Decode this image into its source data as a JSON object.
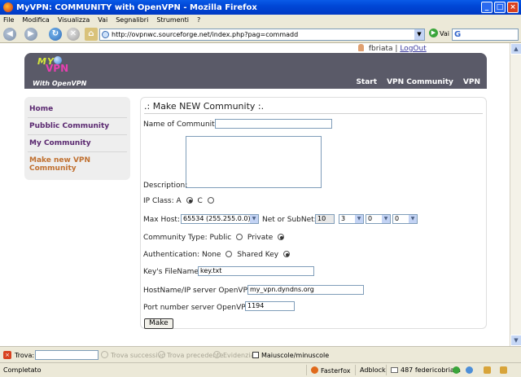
{
  "window": {
    "title": "MyVPN: COMMUNITY with OpenVPN - Mozilla Firefox"
  },
  "menu": [
    "File",
    "Modifica",
    "Visualizza",
    "Vai",
    "Segnalibri",
    "Strumenti",
    "?"
  ],
  "navbar": {
    "url": "http://ovpnwc.sourceforge.net/index.php?pag=commadd",
    "go_label": "Vai"
  },
  "userbar": {
    "username": "fbriata",
    "separator": "|",
    "logout": "LogOut"
  },
  "header": {
    "logo_my": "MY",
    "logo_vpn": "VPN",
    "logo_with": "With OpenVPN",
    "nav": [
      "Start",
      "VPN Community",
      "VPN"
    ]
  },
  "sidebar": {
    "items": [
      "Home",
      "Pubblic Community",
      "My Community",
      "Make new VPN Community"
    ]
  },
  "form": {
    "title": ".: Make NEW Community :.",
    "name_label": "Name of Community:",
    "name_value": "",
    "description_label": "Description:",
    "ipclass_label": "IP Class:",
    "ipclass_a": "A",
    "ipclass_c": "C",
    "maxhost_label": "Max Host:",
    "maxhost_value": "65534 (255.255.0.0)",
    "net_label": "Net or SubNet:",
    "net_values": [
      "10",
      "3",
      "0",
      "0"
    ],
    "type_label": "Community Type:",
    "type_public": "Public",
    "type_private": "Private",
    "auth_label": "Authentication:",
    "auth_none": "None",
    "auth_shared": "Shared Key",
    "keyfile_label": "Key's FileName:",
    "keyfile_value": "key.txt",
    "host_label": "HostName/IP server OpenVPN:",
    "host_value": "my_vpn.dyndns.org",
    "port_label": "Port number server OpenVPN:",
    "port_value": "1194",
    "submit_label": "Make"
  },
  "findbar": {
    "label": "Trova:",
    "next": "Trova successivo",
    "prev": "Trova precedente",
    "highlight": "Evidenzia",
    "matchcase": "Maiuscole/minuscole"
  },
  "statusbar": {
    "status": "Completato",
    "fasterfox": "Fasterfox",
    "adblock": "Adblock",
    "mail": "487 federicobriata"
  }
}
